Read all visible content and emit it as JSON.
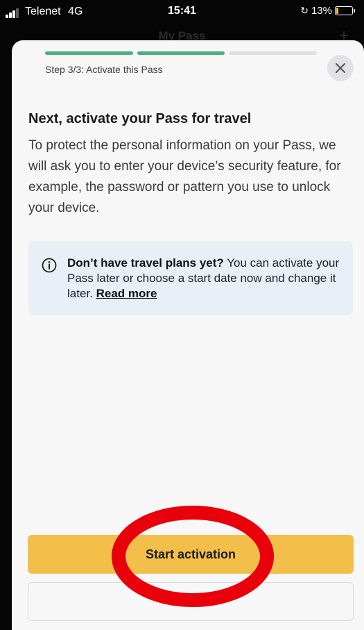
{
  "status_bar": {
    "carrier": "Telenet",
    "network": "4G",
    "time": "15:41",
    "battery_percent": "13%",
    "battery_level": 0.13,
    "battery_color": "#f6c23a"
  },
  "background_header": {
    "title": "My Pass"
  },
  "sheet": {
    "progress": {
      "total_steps": 3,
      "completed_steps": 2,
      "active_color": "#4caf7f",
      "inactive_color": "#e0e0e2"
    },
    "step_label": "Step 3/3: Activate this Pass",
    "close_icon": "close-icon",
    "heading": "Next, activate your Pass for travel",
    "body": "To protect the personal information on your Pass, we will ask you to enter your device’s security feature, for example, the password or pattern you use to unlock your device.",
    "info": {
      "icon": "info-icon",
      "bold_text": "Don’t have travel plans yet?",
      "text": " You can activate your Pass later or choose a start date now and change it later. ",
      "link_text": "Read more"
    },
    "primary_button": "Start activation",
    "primary_button_color": "#f3bf4b",
    "annotation_color": "#e8000b"
  }
}
